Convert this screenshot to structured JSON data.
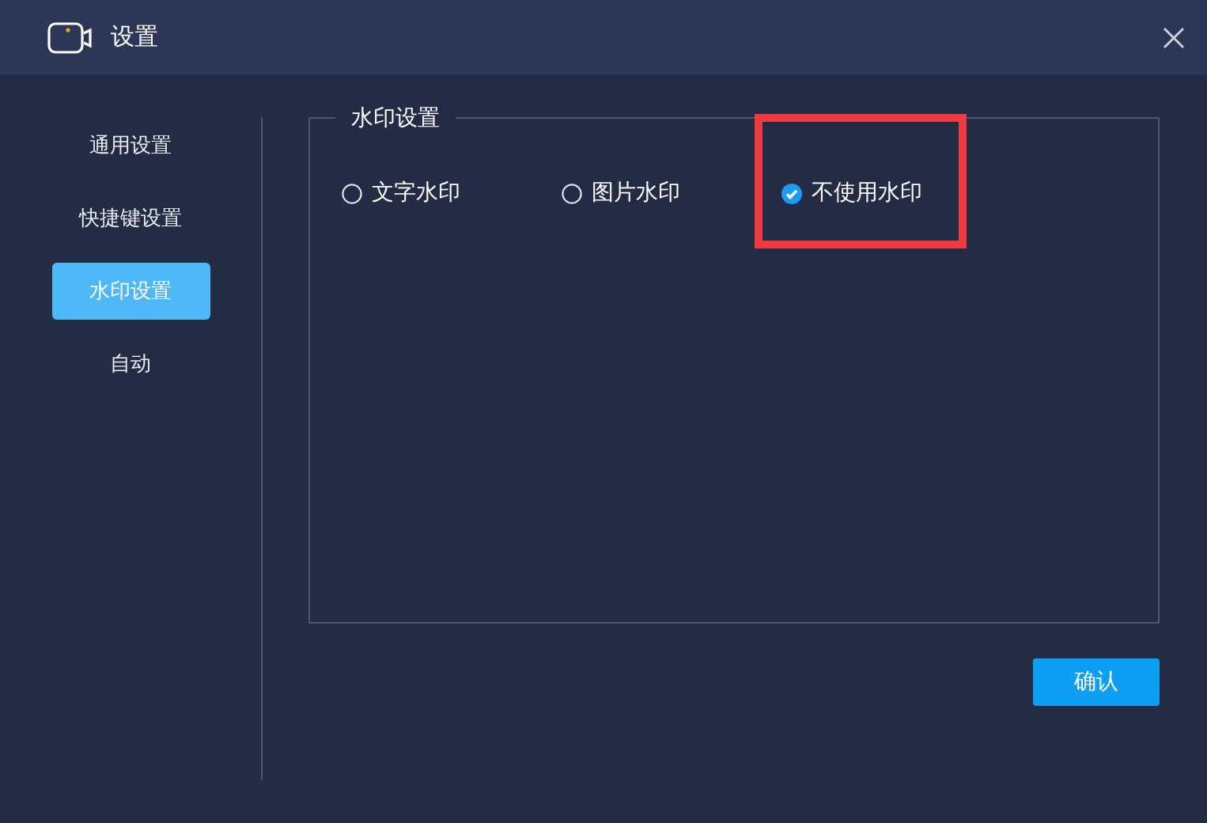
{
  "window": {
    "title": "设置"
  },
  "sidebar": {
    "items": [
      {
        "label": "通用设置",
        "selected": false
      },
      {
        "label": "快捷键设置",
        "selected": false
      },
      {
        "label": "水印设置",
        "selected": true
      },
      {
        "label": "自动",
        "selected": false
      }
    ]
  },
  "group": {
    "title": "水印设置",
    "options": [
      {
        "label": "文字水印",
        "selected": false,
        "highlighted": false
      },
      {
        "label": "图片水印",
        "selected": false,
        "highlighted": false
      },
      {
        "label": "不使用水印",
        "selected": true,
        "highlighted": true
      }
    ]
  },
  "buttons": [
    "确认"
  ]
}
